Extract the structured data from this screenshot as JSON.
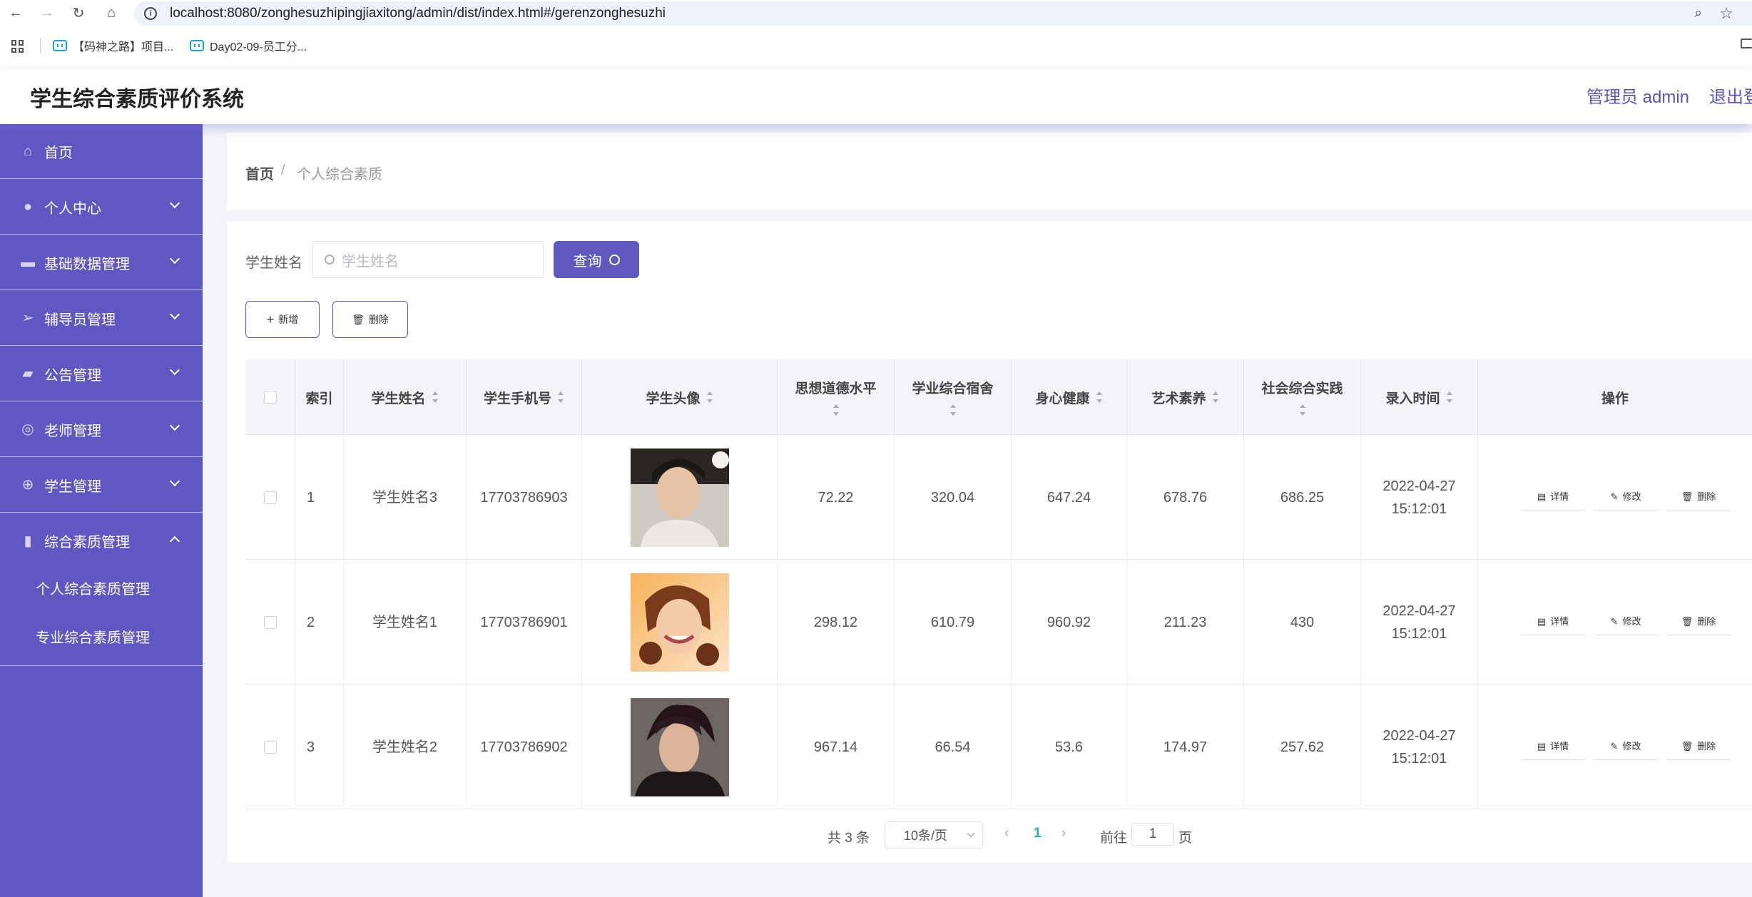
{
  "browser": {
    "url": "localhost:8080/zonghesuzhipingjiaxitong/admin/dist/index.html#/gerenzonghesuzhi",
    "bookmarks": [
      "【码神之路】项目...",
      "Day02-09-员工分..."
    ]
  },
  "header": {
    "title": "学生综合素质评价系统",
    "user": "管理员 admin",
    "logout": "退出登录"
  },
  "sidebar": {
    "items": [
      {
        "label": "首页",
        "icon": "home-icon"
      },
      {
        "label": "个人中心",
        "icon": "user-icon"
      },
      {
        "label": "基础数据管理",
        "icon": "chat-icon"
      },
      {
        "label": "辅导员管理",
        "icon": "send-icon"
      },
      {
        "label": "公告管理",
        "icon": "ticket-icon"
      },
      {
        "label": "老师管理",
        "icon": "target-icon"
      },
      {
        "label": "学生管理",
        "icon": "compass-icon"
      },
      {
        "label": "综合素质管理",
        "icon": "bar-chart-icon"
      }
    ],
    "submenu": [
      "个人综合素质管理",
      "专业综合素质管理"
    ]
  },
  "breadcrumb": {
    "home": "首页",
    "separator": "/",
    "current": "个人综合素质"
  },
  "search": {
    "label": "学生姓名",
    "placeholder": "学生姓名",
    "query_label": "查询"
  },
  "actions": {
    "add_label": "新增",
    "delete_label": "删除"
  },
  "table": {
    "headers": {
      "index": "索引",
      "name": "学生姓名",
      "phone": "学生手机号",
      "avatar": "学生头像",
      "moral": "思想道德水平",
      "academic": "学业综合宿舍",
      "health": "身心健康",
      "art": "艺术素养",
      "social": "社会综合实践",
      "time": "录入时间",
      "ops": "操作"
    },
    "rows": [
      {
        "index": "1",
        "name": "学生姓名3",
        "phone": "17703786903",
        "moral": "72.22",
        "academic": "320.04",
        "health": "647.24",
        "art": "678.76",
        "social": "686.25",
        "time": "2022-04-27 15:12:01"
      },
      {
        "index": "2",
        "name": "学生姓名1",
        "phone": "17703786901",
        "moral": "298.12",
        "academic": "610.79",
        "health": "960.92",
        "art": "211.23",
        "social": "430",
        "time": "2022-04-27 15:12:01"
      },
      {
        "index": "3",
        "name": "学生姓名2",
        "phone": "17703786902",
        "moral": "967.14",
        "academic": "66.54",
        "health": "53.6",
        "art": "174.97",
        "social": "257.62",
        "time": "2022-04-27 15:12:01"
      }
    ],
    "row_ops": {
      "detail": "详情",
      "edit": "修改",
      "delete": "删除"
    }
  },
  "pagination": {
    "total": "共 3 条",
    "page_size": "10条/页",
    "current_page": "1",
    "goto_label": "前往",
    "goto_value": "1",
    "page_unit": "页"
  },
  "colors": {
    "accent": "#5f59bf",
    "sidebar": "#6058c2",
    "page_active": "#20b2a0"
  }
}
